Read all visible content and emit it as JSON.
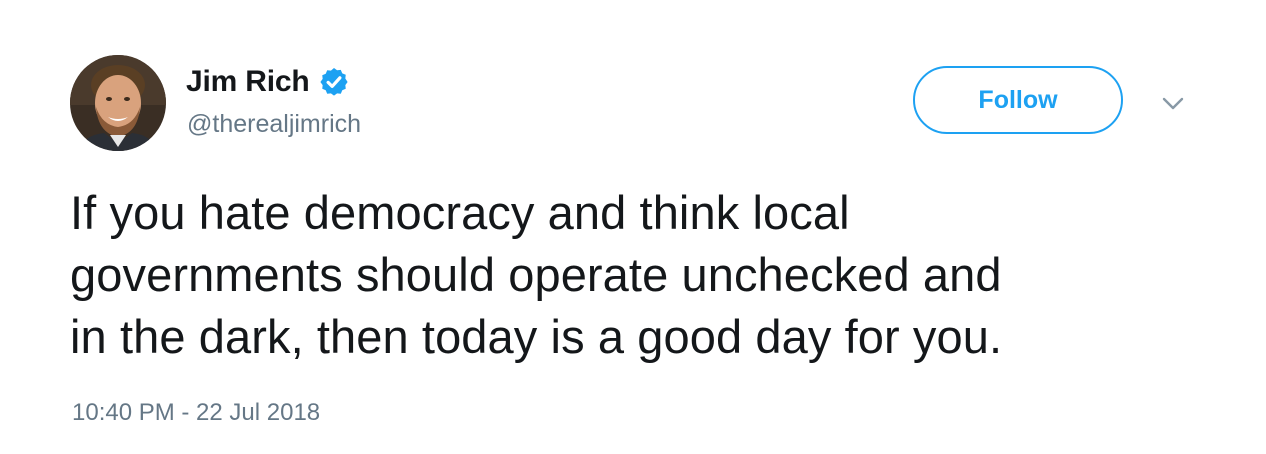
{
  "user": {
    "display_name": "Jim Rich",
    "handle": "@therealjimrich",
    "verified_icon": "verified-badge-icon",
    "avatar": "profile-photo"
  },
  "actions": {
    "follow_label": "Follow",
    "more_icon": "chevron-down-icon"
  },
  "tweet": {
    "text_lines": [
      "If you hate democracy and think local",
      "governments should operate unchecked and",
      "in the dark, then today is a good day for you."
    ],
    "timestamp": "10:40 PM - 22 Jul 2018"
  },
  "colors": {
    "accent": "#1da1f2",
    "text": "#14171a",
    "secondary_text": "#657786",
    "background": "#ffffff"
  }
}
